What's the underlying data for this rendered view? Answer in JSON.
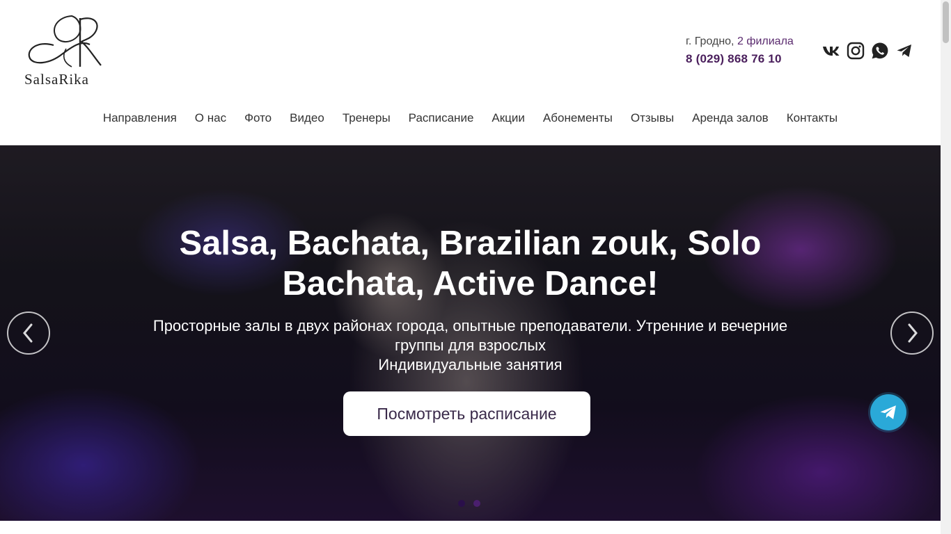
{
  "logo": {
    "text": "SalsaRika",
    "icon": "sr-monogram-icon"
  },
  "contact": {
    "city": "г. Гродно,",
    "branches": "2 филиала",
    "phone": "8 (029) 868 76 10"
  },
  "socials": [
    {
      "name": "vk",
      "icon": "vk-icon"
    },
    {
      "name": "instagram",
      "icon": "instagram-icon"
    },
    {
      "name": "whatsapp",
      "icon": "whatsapp-icon"
    },
    {
      "name": "telegram",
      "icon": "telegram-icon"
    }
  ],
  "nav": {
    "items": [
      {
        "label": "Направления"
      },
      {
        "label": "О нас"
      },
      {
        "label": "Фото"
      },
      {
        "label": "Видео"
      },
      {
        "label": "Тренеры"
      },
      {
        "label": "Расписание"
      },
      {
        "label": "Акции"
      },
      {
        "label": "Абонементы"
      },
      {
        "label": "Отзывы"
      },
      {
        "label": "Аренда залов"
      },
      {
        "label": "Контакты"
      }
    ]
  },
  "hero": {
    "title": "Salsa, Bachata, Brazilian zouk, Solo Bachata, Active Dance!",
    "subtitle_line1": "Просторные залы в двух районах города, опытные преподаватели. Утренние и вечерние группы для взрослых",
    "subtitle_line2": "Индивидуальные занятия",
    "cta_label": "Посмотреть расписание",
    "prev_icon": "chevron-left-icon",
    "next_icon": "chevron-right-icon",
    "slides_total": 2,
    "active_slide": 1
  },
  "floating": {
    "icon": "telegram-icon"
  },
  "colors": {
    "brand": "#4a1f5c",
    "telegram": "#2aa9d8",
    "nav_text": "#333333"
  }
}
